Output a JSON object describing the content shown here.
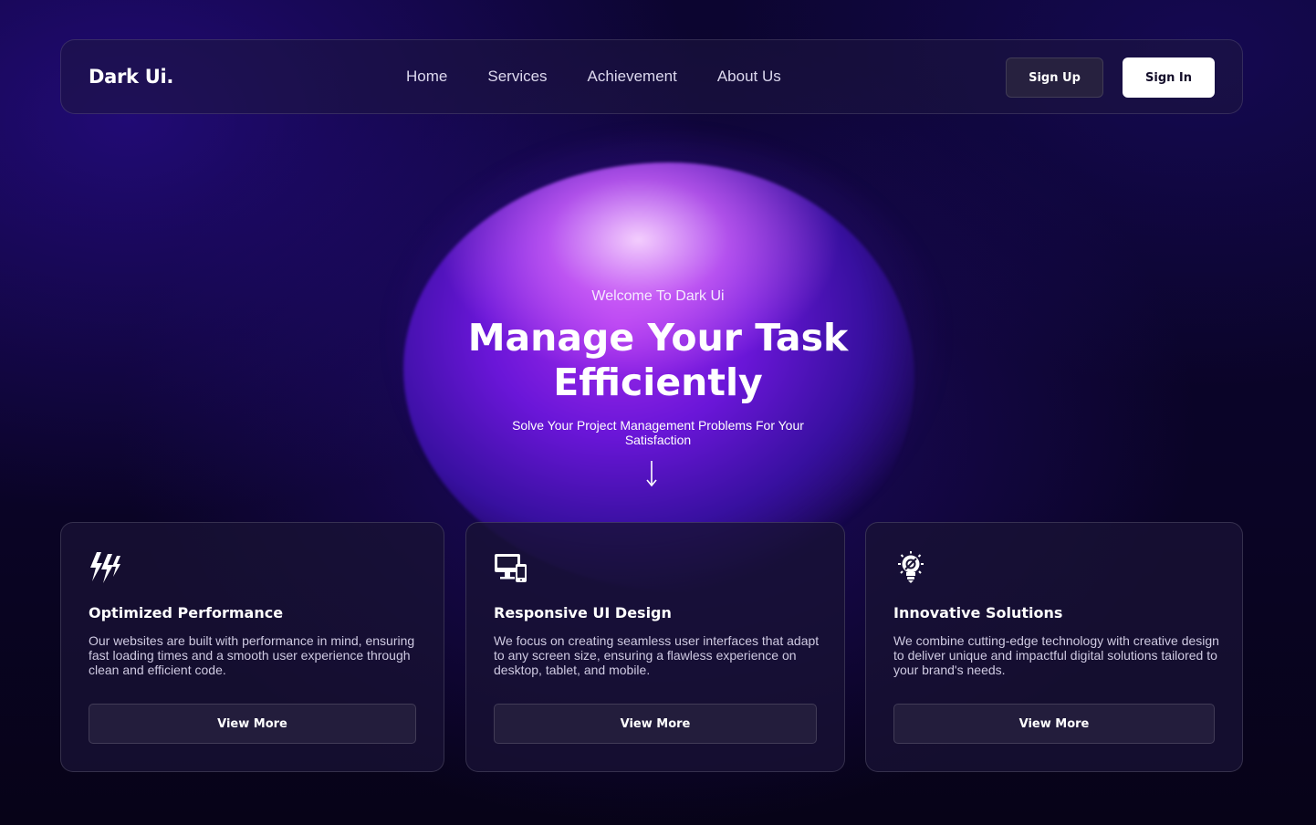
{
  "brand": {
    "logo": "Dark Ui."
  },
  "nav": {
    "links": [
      "Home",
      "Services",
      "Achievement",
      "About Us"
    ],
    "signup_label": "Sign Up",
    "signin_label": "Sign In"
  },
  "hero": {
    "kicker": "Welcome To Dark Ui",
    "title": "Manage Your Task Efficiently",
    "subtitle": "Solve Your Project Management Problems For Your Satisfaction",
    "scroll_icon": "arrow-down-icon"
  },
  "cards": [
    {
      "icon": "lightning-icon",
      "title": "Optimized Performance",
      "description": "Our websites are built with performance in mind, ensuring fast loading times and a smooth user experience through clean and efficient code.",
      "button": "View More"
    },
    {
      "icon": "devices-icon",
      "title": "Responsive UI Design",
      "description": "We focus on creating seamless user interfaces that adapt to any screen size, ensuring a flawless experience on desktop, tablet, and mobile.",
      "button": "View More"
    },
    {
      "icon": "lightbulb-icon",
      "title": "Innovative Solutions",
      "description": "We combine cutting-edge technology with creative design to deliver unique and impactful digital solutions tailored to your brand's needs.",
      "button": "View More"
    }
  ],
  "colors": {
    "background": "#0a0426",
    "blob_purple": "#a32bec",
    "card_bg": "#181234",
    "signin_bg": "#ffffff"
  }
}
